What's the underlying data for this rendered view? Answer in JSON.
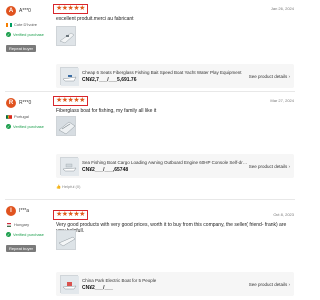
{
  "reviews": [
    {
      "avatar_letter": "A",
      "avatar_color": "#e0531f",
      "username": "A***0",
      "country": "Cote D'Ivoire",
      "verified": "Verified purchase",
      "badge": "Repeat buyer",
      "stars": "★★★★★",
      "rating": 5,
      "date": "Jan 26, 2024",
      "text": "excellent produit.merci au fabricant",
      "has_photo": true,
      "helpful": "",
      "product": {
        "title": "Cheap 6 Seats Fiberglass Fishing Bait Speed Boat Yacht Water Play Equipment",
        "price": "CN¥2,7___/___5,691.76",
        "see_details": "See product details ›"
      }
    },
    {
      "avatar_letter": "R",
      "avatar_color": "#e0531f",
      "username": "R***0",
      "country": "Portugal",
      "verified": "Verified purchase",
      "badge": "",
      "stars": "★★★★★",
      "rating": 5,
      "date": "Mar 27, 2024",
      "text": "Fiberglass boat for fishing, my family all like it",
      "has_photo": true,
      "helpful": "Helpful (0)",
      "product": {
        "title": "Sea Fishing Boat Cargo Loading Awning Outboard Engine 60HP Console Self-draini...",
        "price": "CN¥2___/___,65748",
        "see_details": "See product details ›"
      }
    },
    {
      "avatar_letter": "I",
      "avatar_color": "#e0531f",
      "username": "I***a",
      "country": "Hungary",
      "verified": "Verified purchase",
      "badge": "Repeat buyer",
      "stars": "★★★★★",
      "rating": 5,
      "date": "Oct 8, 2023",
      "text": "Very good products with very good prices, worth it to buy from this company, the seller( friend- frank) are very helpfull.",
      "has_photo": true,
      "helpful": "",
      "product": {
        "title": "China Park Electric Boat for 5 People",
        "price": "CN¥2___/___",
        "see_details": "See product details ›"
      }
    }
  ]
}
